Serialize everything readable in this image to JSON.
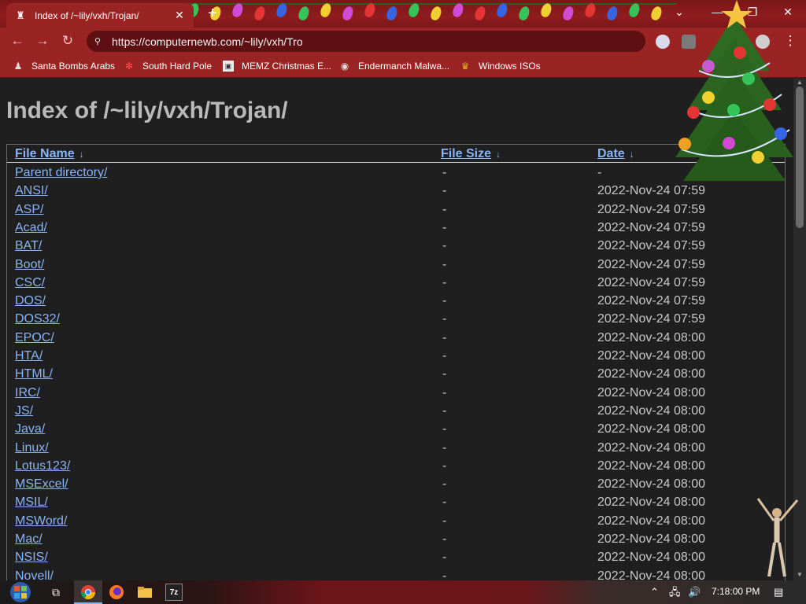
{
  "browser": {
    "tab_title": "Index of /~lily/vxh/Trojan/",
    "new_tab_label": "+",
    "url": "https://computernewb.com/~lily/vxh/Tro",
    "accent": "#9a2324"
  },
  "bookmarks": [
    {
      "label": "Santa Bombs Arabs",
      "icon": "figure-icon"
    },
    {
      "label": "South Hard Pole",
      "icon": "snowflake-icon"
    },
    {
      "label": "MEMZ Christmas E...",
      "icon": "image-icon"
    },
    {
      "label": "Endermanch Malwa...",
      "icon": "raccoon-icon"
    },
    {
      "label": "Windows ISOs",
      "icon": "trophy-icon"
    }
  ],
  "page": {
    "heading": "Index of /~lily/vxh/Trojan/",
    "columns": {
      "name": "File Name",
      "size": "File Size",
      "date": "Date",
      "sort_glyph": "↓"
    },
    "rows": [
      {
        "name": "Parent directory/",
        "size": "-",
        "date": "-"
      },
      {
        "name": "ANSI/",
        "size": "-",
        "date": "2022-Nov-24 07:59"
      },
      {
        "name": "ASP/",
        "size": "-",
        "date": "2022-Nov-24 07:59"
      },
      {
        "name": "Acad/",
        "size": "-",
        "date": "2022-Nov-24 07:59"
      },
      {
        "name": "BAT/",
        "size": "-",
        "date": "2022-Nov-24 07:59"
      },
      {
        "name": "Boot/",
        "size": "-",
        "date": "2022-Nov-24 07:59"
      },
      {
        "name": "CSC/",
        "size": "-",
        "date": "2022-Nov-24 07:59"
      },
      {
        "name": "DOS/",
        "size": "-",
        "date": "2022-Nov-24 07:59"
      },
      {
        "name": "DOS32/",
        "size": "-",
        "date": "2022-Nov-24 07:59"
      },
      {
        "name": "EPOC/",
        "size": "-",
        "date": "2022-Nov-24 08:00"
      },
      {
        "name": "HTA/",
        "size": "-",
        "date": "2022-Nov-24 08:00"
      },
      {
        "name": "HTML/",
        "size": "-",
        "date": "2022-Nov-24 08:00"
      },
      {
        "name": "IRC/",
        "size": "-",
        "date": "2022-Nov-24 08:00"
      },
      {
        "name": "JS/",
        "size": "-",
        "date": "2022-Nov-24 08:00"
      },
      {
        "name": "Java/",
        "size": "-",
        "date": "2022-Nov-24 08:00"
      },
      {
        "name": "Linux/",
        "size": "-",
        "date": "2022-Nov-24 08:00"
      },
      {
        "name": "Lotus123/",
        "size": "-",
        "date": "2022-Nov-24 08:00"
      },
      {
        "name": "MSExcel/",
        "size": "-",
        "date": "2022-Nov-24 08:00"
      },
      {
        "name": "MSIL/",
        "size": "-",
        "date": "2022-Nov-24 08:00"
      },
      {
        "name": "MSWord/",
        "size": "-",
        "date": "2022-Nov-24 08:00"
      },
      {
        "name": "Mac/",
        "size": "-",
        "date": "2022-Nov-24 08:00"
      },
      {
        "name": "NSIS/",
        "size": "-",
        "date": "2022-Nov-24 08:00"
      },
      {
        "name": "Novell/",
        "size": "-",
        "date": "2022-Nov-24 08:00"
      }
    ],
    "link_color": "#8ab4f8"
  },
  "taskbar": {
    "clock": "7:18:00 PM",
    "apps": [
      "task-view-icon",
      "chrome-icon",
      "firefox-icon",
      "file-explorer-icon",
      "7zip-icon"
    ]
  }
}
